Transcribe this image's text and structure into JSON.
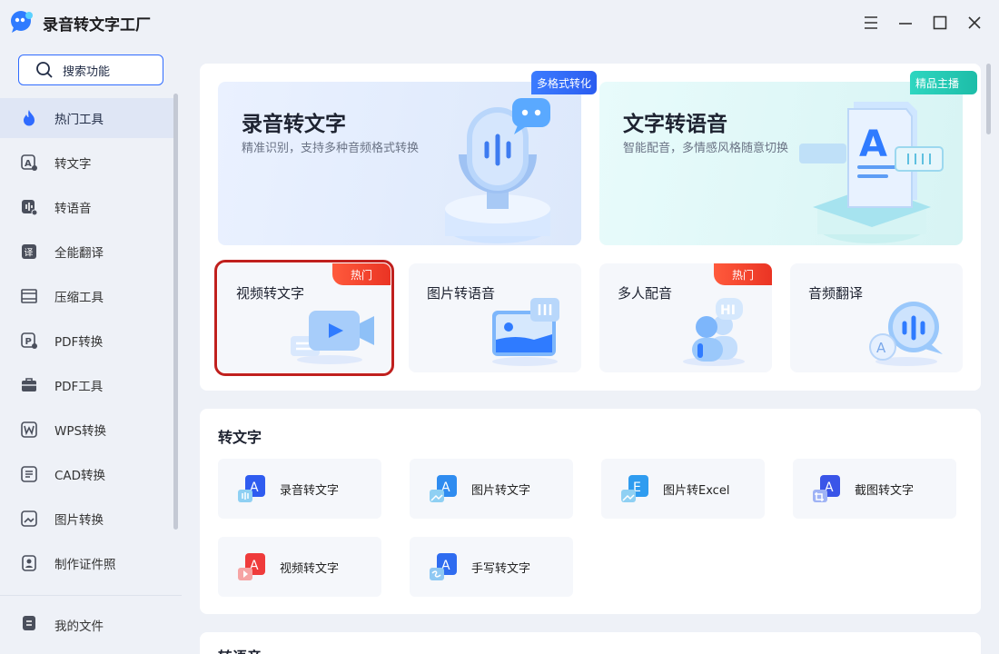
{
  "app": {
    "title": "录音转文字工厂"
  },
  "sidebar": {
    "search_label": "搜索功能",
    "items": [
      {
        "label": "热门工具",
        "icon": "flame-icon",
        "active": true
      },
      {
        "label": "转文字",
        "icon": "text-convert-icon"
      },
      {
        "label": "转语音",
        "icon": "voice-convert-icon"
      },
      {
        "label": "全能翻译",
        "icon": "translate-icon"
      },
      {
        "label": "压缩工具",
        "icon": "compress-icon"
      },
      {
        "label": "PDF转换",
        "icon": "pdf-convert-icon"
      },
      {
        "label": "PDF工具",
        "icon": "toolbox-icon"
      },
      {
        "label": "WPS转换",
        "icon": "wps-icon"
      },
      {
        "label": "CAD转换",
        "icon": "cad-icon"
      },
      {
        "label": "图片转换",
        "icon": "image-convert-icon"
      },
      {
        "label": "制作证件照",
        "icon": "id-photo-icon"
      }
    ],
    "files_label": "我的文件"
  },
  "hero": [
    {
      "title": "录音转文字",
      "subtitle": "精准识别，支持多种音频格式转换",
      "badge": "多格式转化"
    },
    {
      "title": "文字转语音",
      "subtitle": "智能配音，多情感风格随意切换",
      "badge": "精品主播"
    }
  ],
  "tiles": [
    {
      "title": "视频转文字",
      "badge": "热门"
    },
    {
      "title": "图片转语音"
    },
    {
      "title": "多人配音",
      "badge": "热门"
    },
    {
      "title": "音频翻译"
    }
  ],
  "wen_section": {
    "title": "转文字",
    "tools": [
      "录音转文字",
      "图片转文字",
      "图片转Excel",
      "截图转文字",
      "视频转文字",
      "手写转文字"
    ]
  },
  "next_section": {
    "title": "转语音"
  },
  "colors": {
    "accent": "#2f6bff",
    "hot": "#ea3424",
    "highlight": "#c0201e",
    "teal": "#1dbda8"
  }
}
